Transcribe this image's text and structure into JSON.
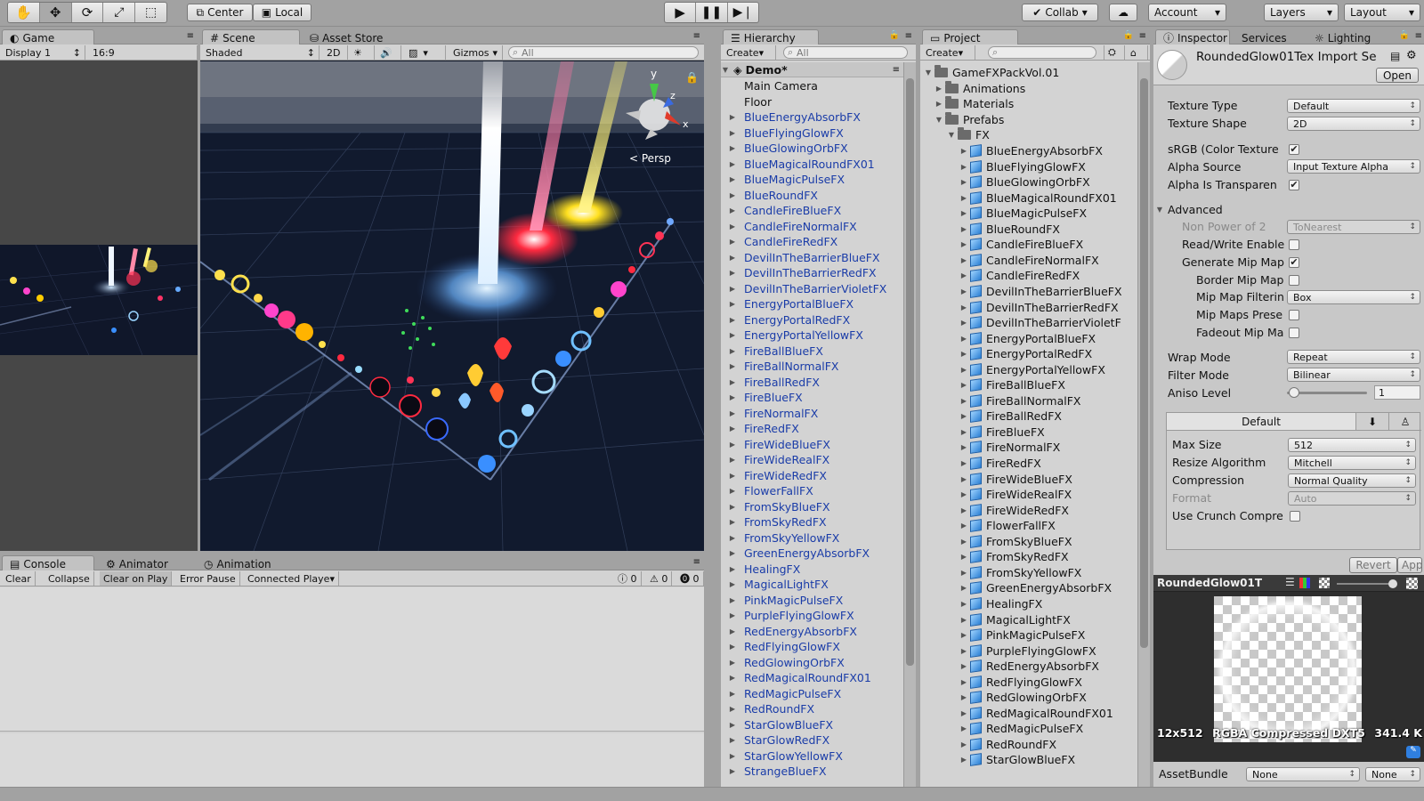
{
  "toolbar": {
    "center_label": "Center",
    "local_label": "Local",
    "collab_label": "Collab",
    "account_label": "Account",
    "layers_label": "Layers",
    "layout_label": "Layout"
  },
  "game": {
    "tab": "Game",
    "display": "Display 1",
    "aspect": "16:9"
  },
  "scene": {
    "tab": "Scene",
    "asset_store_tab": "Asset Store",
    "shading": "Shaded",
    "mode_2d": "2D",
    "gizmos": "Gizmos",
    "search_placeholder": "All",
    "persp_label": "Persp",
    "axis_y": "y",
    "axis_z": "z",
    "axis_x": "x"
  },
  "console": {
    "tab": "Console",
    "animator_tab": "Animator",
    "animation_tab": "Animation",
    "clear": "Clear",
    "collapse": "Collapse",
    "clear_on_play": "Clear on Play",
    "error_pause": "Error Pause",
    "connected_player": "Connected Playe",
    "info_count": "0",
    "warn_count": "0",
    "error_count": "0"
  },
  "hierarchy": {
    "tab": "Hierarchy",
    "create": "Create",
    "search_placeholder": "All",
    "scene_name": "Demo*",
    "items": [
      "Main Camera",
      "Floor",
      "BlueEnergyAbsorbFX",
      "BlueFlyingGlowFX",
      "BlueGlowingOrbFX",
      "BlueMagicalRoundFX01",
      "BlueMagicPulseFX",
      "BlueRoundFX",
      "CandleFireBlueFX",
      "CandleFireNormalFX",
      "CandleFireRedFX",
      "DevilInTheBarrierBlueFX",
      "DevilInTheBarrierRedFX",
      "DevilInTheBarrierVioletFX",
      "EnergyPortalBlueFX",
      "EnergyPortalRedFX",
      "EnergyPortalYellowFX",
      "FireBallBlueFX",
      "FireBallNormalFX",
      "FireBallRedFX",
      "FireBlueFX",
      "FireNormalFX",
      "FireRedFX",
      "FireWideBlueFX",
      "FireWideRealFX",
      "FireWideRedFX",
      "FlowerFallFX",
      "FromSkyBlueFX",
      "FromSkyRedFX",
      "FromSkyYellowFX",
      "GreenEnergyAbsorbFX",
      "HealingFX",
      "MagicalLightFX",
      "PinkMagicPulseFX",
      "PurpleFlyingGlowFX",
      "RedEnergyAbsorbFX",
      "RedFlyingGlowFX",
      "RedGlowingOrbFX",
      "RedMagicalRoundFX01",
      "RedMagicPulseFX",
      "RedRoundFX",
      "StarGlowBlueFX",
      "StarGlowRedFX",
      "StarGlowYellowFX",
      "StrangeBlueFX"
    ]
  },
  "project": {
    "tab": "Project",
    "create": "Create",
    "root": "GameFXPackVol.01",
    "animations": "Animations",
    "materials": "Materials",
    "prefabs": "Prefabs",
    "fx": "FX",
    "items": [
      "BlueEnergyAbsorbFX",
      "BlueFlyingGlowFX",
      "BlueGlowingOrbFX",
      "BlueMagicalRoundFX01",
      "BlueMagicPulseFX",
      "BlueRoundFX",
      "CandleFireBlueFX",
      "CandleFireNormalFX",
      "CandleFireRedFX",
      "DevilInTheBarrierBlueFX",
      "DevilInTheBarrierRedFX",
      "DevilInTheBarrierVioletF",
      "EnergyPortalBlueFX",
      "EnergyPortalRedFX",
      "EnergyPortalYellowFX",
      "FireBallBlueFX",
      "FireBallNormalFX",
      "FireBallRedFX",
      "FireBlueFX",
      "FireNormalFX",
      "FireRedFX",
      "FireWideBlueFX",
      "FireWideRealFX",
      "FireWideRedFX",
      "FlowerFallFX",
      "FromSkyBlueFX",
      "FromSkyRedFX",
      "FromSkyYellowFX",
      "GreenEnergyAbsorbFX",
      "HealingFX",
      "MagicalLightFX",
      "PinkMagicPulseFX",
      "PurpleFlyingGlowFX",
      "RedEnergyAbsorbFX",
      "RedFlyingGlowFX",
      "RedGlowingOrbFX",
      "RedMagicalRoundFX01",
      "RedMagicPulseFX",
      "RedRoundFX",
      "StarGlowBlueFX"
    ]
  },
  "inspector": {
    "tab": "Inspector",
    "services_tab": "Services",
    "lighting_tab": "Lighting",
    "asset_title": "RoundedGlow01Tex Import Se",
    "open_button": "Open",
    "texture_type_label": "Texture Type",
    "texture_type_value": "Default",
    "texture_shape_label": "Texture Shape",
    "texture_shape_value": "2D",
    "srgb_label": "sRGB (Color Texture",
    "alpha_source_label": "Alpha Source",
    "alpha_source_value": "Input Texture Alpha",
    "alpha_transparency_label": "Alpha Is Transparen",
    "advanced_label": "Advanced",
    "npot_label": "Non Power of 2",
    "npot_value": "ToNearest",
    "readwrite_label": "Read/Write Enable",
    "gen_mip_label": "Generate Mip Map",
    "border_mip_label": "Border Mip Map",
    "mip_filter_label": "Mip Map Filterin",
    "mip_filter_value": "Box",
    "mip_preserve_label": "Mip Maps Prese",
    "fadeout_label": "Fadeout Mip Ma",
    "wrap_label": "Wrap Mode",
    "wrap_value": "Repeat",
    "filter_label": "Filter Mode",
    "filter_value": "Bilinear",
    "aniso_label": "Aniso Level",
    "aniso_value": "1",
    "platform_tab": "Default",
    "max_size_label": "Max Size",
    "max_size_value": "512",
    "resize_label": "Resize Algorithm",
    "resize_value": "Mitchell",
    "compression_label": "Compression",
    "compression_value": "Normal Quality",
    "format_label": "Format",
    "format_value": "Auto",
    "crunch_label": "Use Crunch Compre",
    "revert_button": "Revert",
    "apply_button": "Apply",
    "preview_title": "RoundedGlow01T",
    "preview_info_size": "12x512",
    "preview_info_format": "RGBA Compressed DXT5",
    "preview_info_mem": "341.4 K",
    "assetbundle_label": "AssetBundle",
    "assetbundle_value": "None",
    "assetbundle_variant": "None"
  }
}
